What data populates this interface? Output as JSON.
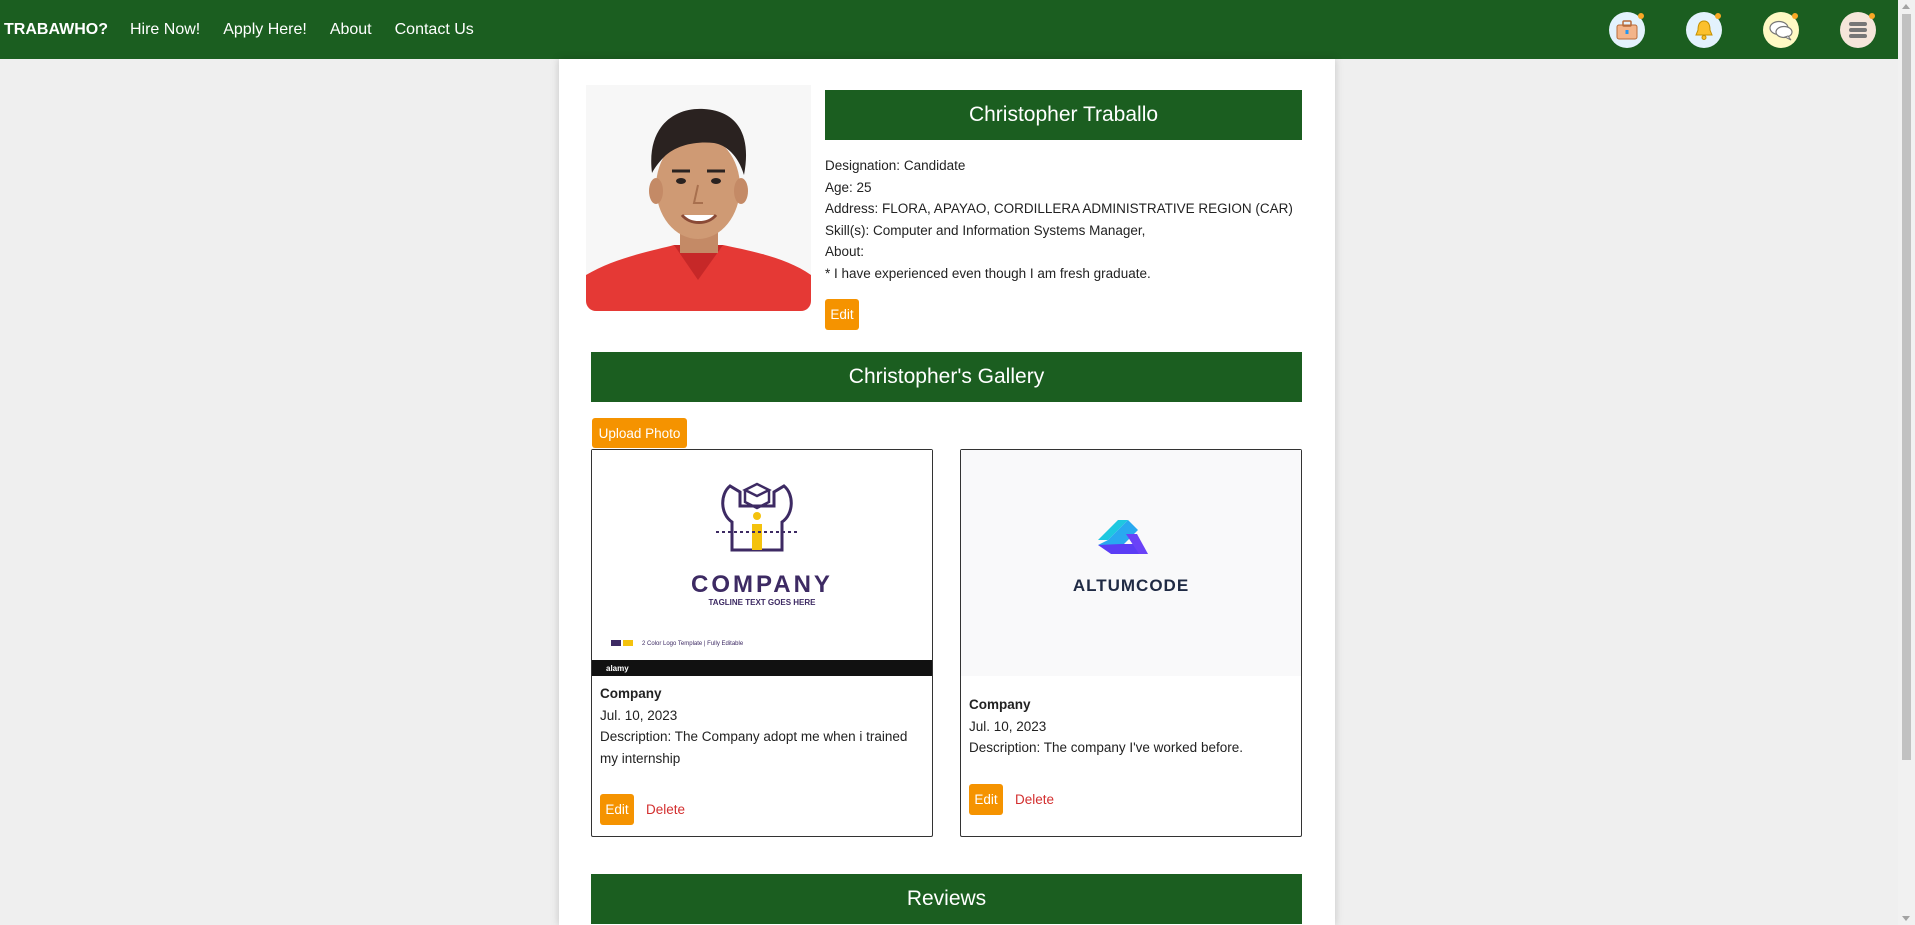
{
  "navbar": {
    "brand": "TRABAWHO?",
    "links": [
      "Hire Now!",
      "Apply Here!",
      "About",
      "Contact Us"
    ],
    "icons": [
      "briefcase-icon",
      "bell-icon",
      "chat-icon",
      "menu-icon"
    ],
    "color": "#1b5e20"
  },
  "profile": {
    "name": "Christopher Traballo",
    "designation_label": "Designation:",
    "designation": "Candidate",
    "age_label": "Age:",
    "age": "25",
    "address_label": "Address:",
    "address": "FLORA, APAYAO, CORDILLERA ADMINISTRATIVE REGION (CAR)",
    "skills_label": "Skill(s):",
    "skills": "Computer and Information Systems Manager,",
    "about_label": "About:",
    "about": "* I have experienced even though I am fresh graduate.",
    "edit_label": "Edit"
  },
  "gallery": {
    "title": "Christopher's Gallery",
    "upload_label": "Upload Photo",
    "items": [
      {
        "logo_text": "COMPANY",
        "logo_tagline": "TAGLINE TEXT GOES HERE",
        "logo_note": "2 Color Logo Template | Fully Editable",
        "watermark": "alamy",
        "title": "Company",
        "date": "Jul. 10, 2023",
        "description_label": "Description:",
        "description": "The Company adopt me when i trained my internship",
        "edit_label": "Edit",
        "delete_label": "Delete"
      },
      {
        "logo_text": "ALTUMCODE",
        "title": "Company",
        "date": "Jul. 10, 2023",
        "description_label": "Description:",
        "description": "The company I've worked before.",
        "edit_label": "Edit",
        "delete_label": "Delete"
      }
    ]
  },
  "reviews": {
    "title": "Reviews"
  },
  "colors": {
    "accent_green": "#1b5e20",
    "button_orange": "#f59300",
    "delete_red": "#d32f2f"
  }
}
